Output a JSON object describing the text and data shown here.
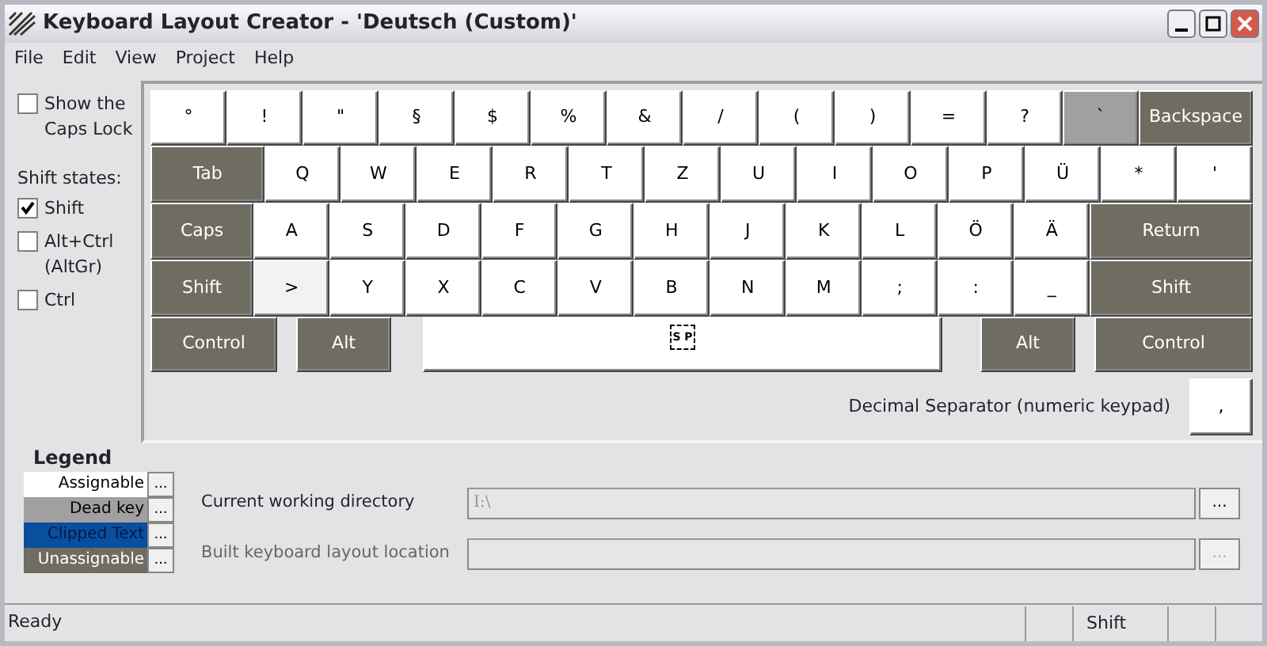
{
  "window": {
    "title": "Keyboard Layout Creator - 'Deutsch (Custom)'"
  },
  "menu": [
    "File",
    "Edit",
    "View",
    "Project",
    "Help"
  ],
  "options": {
    "caps_lock": {
      "label": "Show the Caps Lock",
      "checked": false
    },
    "shift_states_label": "Shift states:",
    "shift_states": [
      {
        "label": "Shift",
        "checked": true
      },
      {
        "label": "Alt+Ctrl (AltGr)",
        "checked": false
      },
      {
        "label": "Ctrl",
        "checked": false
      }
    ]
  },
  "keyboard": {
    "rows": [
      [
        {
          "label": "°",
          "kind": "character"
        },
        {
          "label": "!",
          "kind": "character"
        },
        {
          "label": "\"",
          "kind": "character"
        },
        {
          "label": "§",
          "kind": "character"
        },
        {
          "label": "$",
          "kind": "character"
        },
        {
          "label": "%",
          "kind": "character"
        },
        {
          "label": "&",
          "kind": "character"
        },
        {
          "label": "/",
          "kind": "character"
        },
        {
          "label": "(",
          "kind": "character"
        },
        {
          "label": ")",
          "kind": "character"
        },
        {
          "label": "=",
          "kind": "character"
        },
        {
          "label": "?",
          "kind": "character"
        },
        {
          "label": "`",
          "kind": "dead"
        },
        {
          "label": "Backspace",
          "kind": "modifier"
        }
      ],
      [
        {
          "label": "Tab",
          "kind": "modifier"
        },
        {
          "label": "Q",
          "kind": "character"
        },
        {
          "label": "W",
          "kind": "character"
        },
        {
          "label": "E",
          "kind": "character"
        },
        {
          "label": "R",
          "kind": "character"
        },
        {
          "label": "T",
          "kind": "character"
        },
        {
          "label": "Z",
          "kind": "character"
        },
        {
          "label": "U",
          "kind": "character"
        },
        {
          "label": "I",
          "kind": "character"
        },
        {
          "label": "O",
          "kind": "character"
        },
        {
          "label": "P",
          "kind": "character"
        },
        {
          "label": "Ü",
          "kind": "character"
        },
        {
          "label": "*",
          "kind": "character"
        },
        {
          "label": "'",
          "kind": "character"
        }
      ],
      [
        {
          "label": "Caps",
          "kind": "modifier"
        },
        {
          "label": "A",
          "kind": "character"
        },
        {
          "label": "S",
          "kind": "character"
        },
        {
          "label": "D",
          "kind": "character"
        },
        {
          "label": "F",
          "kind": "character"
        },
        {
          "label": "G",
          "kind": "character"
        },
        {
          "label": "H",
          "kind": "character"
        },
        {
          "label": "J",
          "kind": "character"
        },
        {
          "label": "K",
          "kind": "character"
        },
        {
          "label": "L",
          "kind": "character"
        },
        {
          "label": "Ö",
          "kind": "character"
        },
        {
          "label": "Ä",
          "kind": "character"
        },
        {
          "label": "Return",
          "kind": "modifier"
        }
      ],
      [
        {
          "label": "Shift",
          "kind": "modifier"
        },
        {
          "label": ">",
          "kind": "hover"
        },
        {
          "label": "Y",
          "kind": "character"
        },
        {
          "label": "X",
          "kind": "character"
        },
        {
          "label": "C",
          "kind": "character"
        },
        {
          "label": "V",
          "kind": "character"
        },
        {
          "label": "B",
          "kind": "character"
        },
        {
          "label": "N",
          "kind": "character"
        },
        {
          "label": "M",
          "kind": "character"
        },
        {
          "label": ";",
          "kind": "character"
        },
        {
          "label": ":",
          "kind": "character"
        },
        {
          "label": "_",
          "kind": "character"
        },
        {
          "label": "Shift",
          "kind": "modifier"
        }
      ],
      [
        {
          "label": "Control",
          "kind": "modifier"
        },
        {
          "label": "Alt",
          "kind": "modifier"
        },
        {
          "label": "S P",
          "kind": "space"
        },
        {
          "label": "Alt",
          "kind": "modifier"
        },
        {
          "label": "Control",
          "kind": "modifier"
        }
      ]
    ],
    "decimal_separator": {
      "label": "Decimal Separator (numeric keypad)",
      "key": ","
    }
  },
  "legend": {
    "title": "Legend",
    "items": [
      {
        "label": "Assignable",
        "color": "#ffffff",
        "button": "..."
      },
      {
        "label": "Dead key",
        "color": "#a0a0a0",
        "button": "..."
      },
      {
        "label": "Clipped Text",
        "color": "#0a4f9e",
        "button": "..."
      },
      {
        "label": "Unassignable",
        "color": "#6f6d61",
        "button": "..."
      }
    ]
  },
  "paths": [
    {
      "label": "Current working directory",
      "value": "I:\\",
      "button": "...",
      "disabled": false
    },
    {
      "label": "Built keyboard layout location",
      "button": "...",
      "disabled": true
    }
  ],
  "status_bar": {
    "text": "Ready",
    "panels": [
      "Shift"
    ]
  }
}
